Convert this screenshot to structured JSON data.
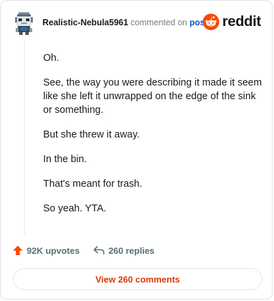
{
  "header": {
    "username": "Realistic-Nebula5961",
    "commented_text": "commented on",
    "post_link": "post",
    "brand": "reddit"
  },
  "comment": {
    "paragraphs": [
      "Oh.",
      "See, the way you were describing it made it seem like she left it unwrapped on the edge of the sink or something.",
      "But she threw it away.",
      "In the bin.",
      "That's meant for trash.",
      "So yeah. YTA."
    ]
  },
  "actions": {
    "upvotes": "92K upvotes",
    "replies": "260 replies"
  },
  "footer": {
    "view_comments": "View 260 comments"
  },
  "colors": {
    "brand_orange": "#ff4500",
    "link_blue": "#0b58c5",
    "action_text": "#576f76",
    "view_comments_text": "#d93900"
  },
  "icons": {
    "avatar": "pixel-avatar-icon",
    "brand": "reddit-snoo-icon",
    "upvote": "upvote-arrow-icon",
    "reply": "reply-arrow-icon"
  }
}
